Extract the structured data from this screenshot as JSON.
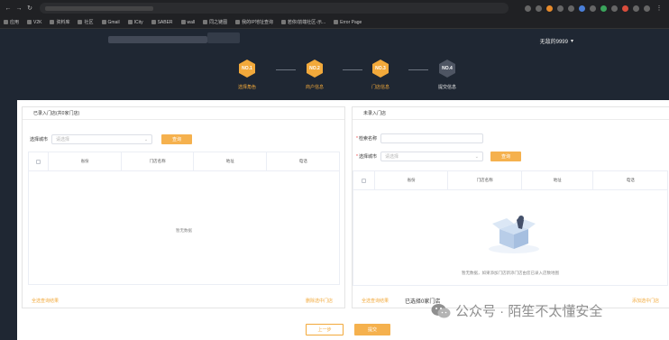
{
  "browser": {
    "bookmarks": [
      "应用",
      "V2K",
      "资料库",
      "社区",
      "Gmail",
      "ICity",
      "SABER",
      "wall",
      "同之链图",
      "我的IP地址查询",
      "若依/前端社区-示...",
      "Error Page"
    ]
  },
  "header": {
    "user_name": "无敌的9999",
    "caret": "▾"
  },
  "steps": [
    {
      "num": "NO.1",
      "label": "选择角色"
    },
    {
      "num": "NO.2",
      "label": "商户信息"
    },
    {
      "num": "NO.3",
      "label": "门店信息"
    },
    {
      "num": "NO.4",
      "label": "提交信息"
    }
  ],
  "left_panel": {
    "title": "已录入门店(共0家门店)",
    "city_label": "选择城市",
    "city_placeholder": "请选择",
    "query_button": "查询",
    "columns": [
      "",
      "省份",
      "门店名称",
      "地址",
      "电话"
    ],
    "empty_text": "暂无数据",
    "select_all_link": "全选查询结果",
    "delete_link": "删除选中门店"
  },
  "right_panel": {
    "title": "未录入门店",
    "search_label": "检索名称",
    "city_label": "选择城市",
    "city_placeholder": "请选择",
    "query_button": "查询",
    "columns": [
      "",
      "省份",
      "门店名称",
      "地址",
      "电话"
    ],
    "empty_text": "暂无数据，如果添加门店新添门店由您已录入店数地图",
    "select_all_link": "全选查询结果",
    "selected_text": "已选择0家门店",
    "add_link": "添加选中门店"
  },
  "footer": {
    "prev_button": "上一步",
    "submit_button": "提交"
  },
  "watermark": {
    "text": "公众号 · 陌笙不太懂安全"
  },
  "colors": {
    "accent": "#f2a93b",
    "header_bg": "#1f2733"
  }
}
